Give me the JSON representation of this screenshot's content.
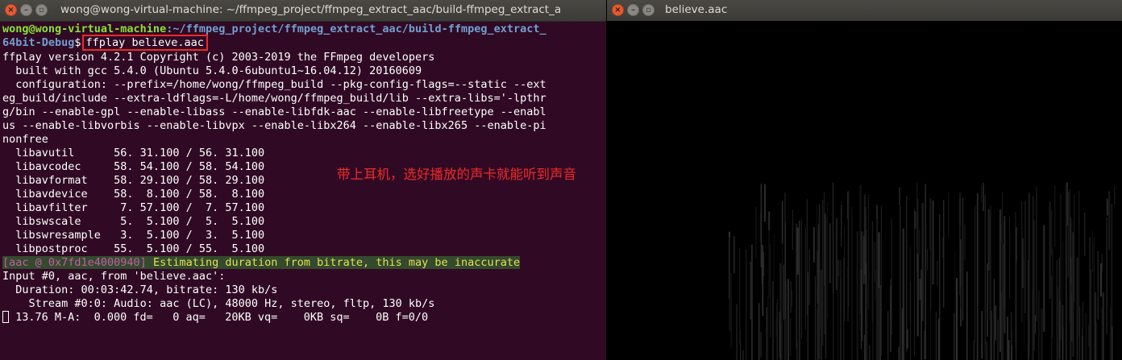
{
  "terminal": {
    "title": "wong@wong-virtual-machine: ~/ffmpeg_project/ffmpeg_extract_aac/build-ffmpeg_extract_a",
    "prompt_user": "wong@wong-virtual-machine",
    "prompt_path_1": ":~/ffmpeg_project/ffmpeg_extract_aac/build-ffmpeg_extract_",
    "prompt_path_2": "64bit-Debug",
    "prompt_symbol": "$",
    "command": "ffplay believe.aac",
    "output_lines": [
      "ffplay version 4.2.1 Copyright (c) 2003-2019 the FFmpeg developers",
      "  built with gcc 5.4.0 (Ubuntu 5.4.0-6ubuntu1~16.04.12) 20160609",
      "  configuration: --prefix=/home/wong/ffmpeg_build --pkg-config-flags=--static --ext",
      "eg_build/include --extra-ldflags=-L/home/wong/ffmpeg_build/lib --extra-libs='-lpthr",
      "g/bin --enable-gpl --enable-libass --enable-libfdk-aac --enable-libfreetype --enabl",
      "us --enable-libvorbis --enable-libvpx --enable-libx264 --enable-libx265 --enable-pi",
      "nonfree",
      "  libavutil      56. 31.100 / 56. 31.100",
      "  libavcodec     58. 54.100 / 58. 54.100",
      "  libavformat    58. 29.100 / 58. 29.100",
      "  libavdevice    58.  8.100 / 58.  8.100",
      "  libavfilter     7. 57.100 /  7. 57.100",
      "  libswscale      5.  5.100 /  5.  5.100",
      "  libswresample   3.  5.100 /  3.  5.100",
      "  libpostproc    55.  5.100 / 55.  5.100"
    ],
    "warning_tag": "[aac @ 0x7fd1e4000940]",
    "warning_message": " Estimating duration from bitrate, this may be inaccurate",
    "input_lines": [
      "Input #0, aac, from 'believe.aac':",
      "  Duration: 00:03:42.74, bitrate: 130 kb/s",
      "    Stream #0:0: Audio: aac (LC), 48000 Hz, stereo, fltp, 130 kb/s"
    ],
    "status_line": " 13.76 M-A:  0.000 fd=   0 aq=   20KB vq=    0KB sq=    0B f=0/0",
    "annotation": "带上耳机，选好播放的声卡就能听到声音"
  },
  "player": {
    "title": "believe.aac"
  },
  "colors": {
    "terminal_bg": "#300a24",
    "prompt_user": "#8ae234",
    "prompt_path": "#729fcf",
    "highlight_box": "#ef2929",
    "warning_tag": "#c15fa4",
    "warning_message": "#e3e052"
  }
}
